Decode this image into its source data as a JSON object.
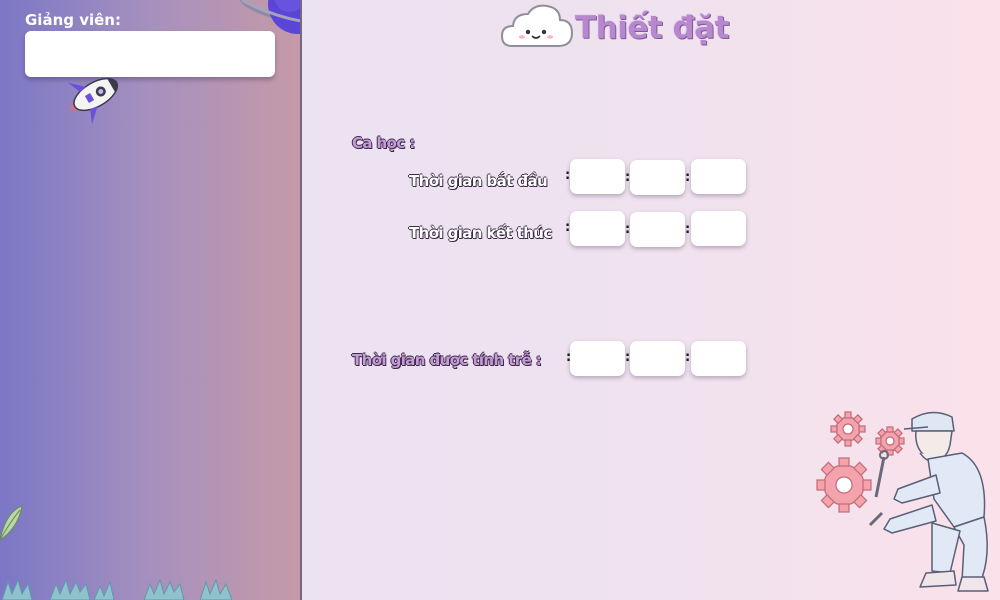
{
  "sidebar": {
    "lecturer_label": "Giảng viên:",
    "lecturer_value": ""
  },
  "header": {
    "title": "Thiết đặt"
  },
  "session": {
    "label": "Ca học :",
    "start_label": "Thời gian bắt đầu",
    "end_label": "Thời gian kết thúc",
    "start_values": [
      "",
      "",
      ""
    ],
    "end_values": [
      "",
      "",
      ""
    ]
  },
  "late": {
    "label": "Thời gian được tính trễ :",
    "values": [
      "",
      "",
      ""
    ]
  },
  "separator": ":",
  "colors": {
    "title": "#b888cf",
    "sidebar_start": "#7b77c6",
    "sidebar_end": "#c59aa8",
    "gear": "#f2a3ac"
  },
  "icons": [
    "planet-icon",
    "rocket-icon",
    "cloud-icon",
    "leaf-icon",
    "grass-icon",
    "gear-icon",
    "mechanic-illustration"
  ]
}
